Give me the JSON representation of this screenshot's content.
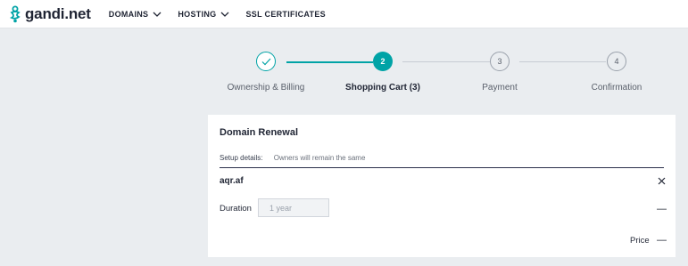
{
  "brand": {
    "name": "gandi.net",
    "color": "#00a3a6"
  },
  "nav": {
    "items": [
      {
        "label": "DOMAINS",
        "has_dropdown": true
      },
      {
        "label": "HOSTING",
        "has_dropdown": true
      },
      {
        "label": "SSL CERTIFICATES",
        "has_dropdown": false
      }
    ]
  },
  "stepper": {
    "steps": [
      {
        "number": "",
        "label": "Ownership & Billing",
        "state": "done",
        "icon": "check-icon"
      },
      {
        "number": "2",
        "label": "Shopping Cart (3)",
        "state": "active"
      },
      {
        "number": "3",
        "label": "Payment",
        "state": "todo"
      },
      {
        "number": "4",
        "label": "Confirmation",
        "state": "todo"
      }
    ]
  },
  "card": {
    "title": "Domain Renewal",
    "setup_label": "Setup details:",
    "setup_value": "Owners will remain the same",
    "domain": "aqr.af",
    "duration_label": "Duration",
    "duration_value": "1 year",
    "duration_price": "—",
    "price_label": "Price",
    "price_value": "—"
  }
}
